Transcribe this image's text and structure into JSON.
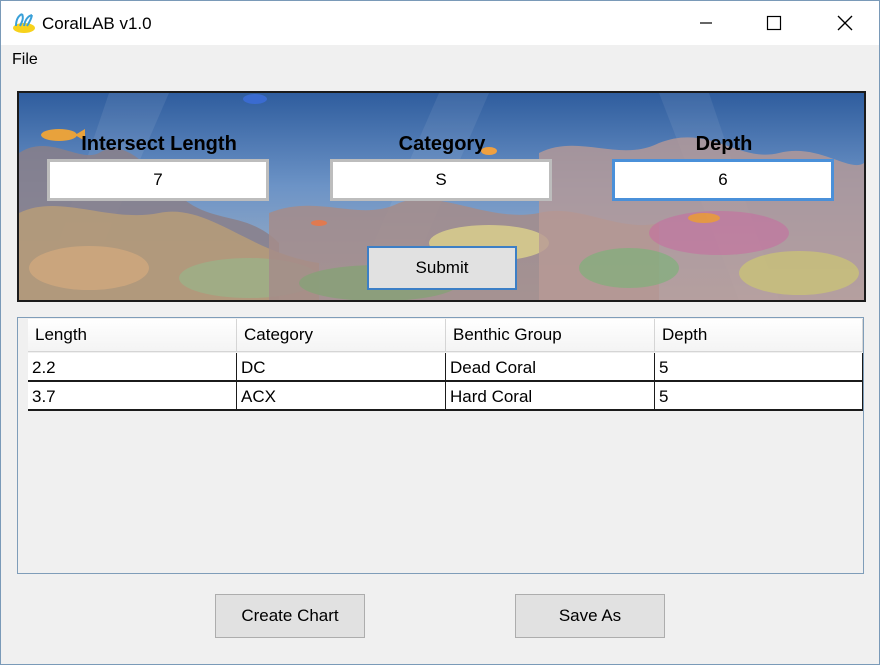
{
  "window": {
    "title": "CoralLAB v1.0",
    "app_icon": "coral-app-icon",
    "controls": [
      "minimize-icon",
      "maximize-icon",
      "close-icon"
    ]
  },
  "menu": {
    "items": [
      {
        "label": "File"
      }
    ]
  },
  "form": {
    "intersect_length": {
      "label": "Intersect Length",
      "value": "7"
    },
    "category": {
      "label": "Category",
      "value": "S"
    },
    "depth": {
      "label": "Depth",
      "value": "6"
    },
    "submit_label": "Submit"
  },
  "table": {
    "columns": [
      "Length",
      "Category",
      "Benthic Group",
      "Depth"
    ],
    "rows": [
      [
        "2.2",
        "DC",
        "Dead Coral",
        "5"
      ],
      [
        "3.7",
        "ACX",
        "Hard Coral",
        "5"
      ]
    ]
  },
  "actions": {
    "create_chart_label": "Create Chart",
    "save_as_label": "Save As"
  },
  "colors": {
    "focus_border": "#4a90d9",
    "button_face": "#e1e1e1",
    "window_bg": "#f0f0f0"
  }
}
